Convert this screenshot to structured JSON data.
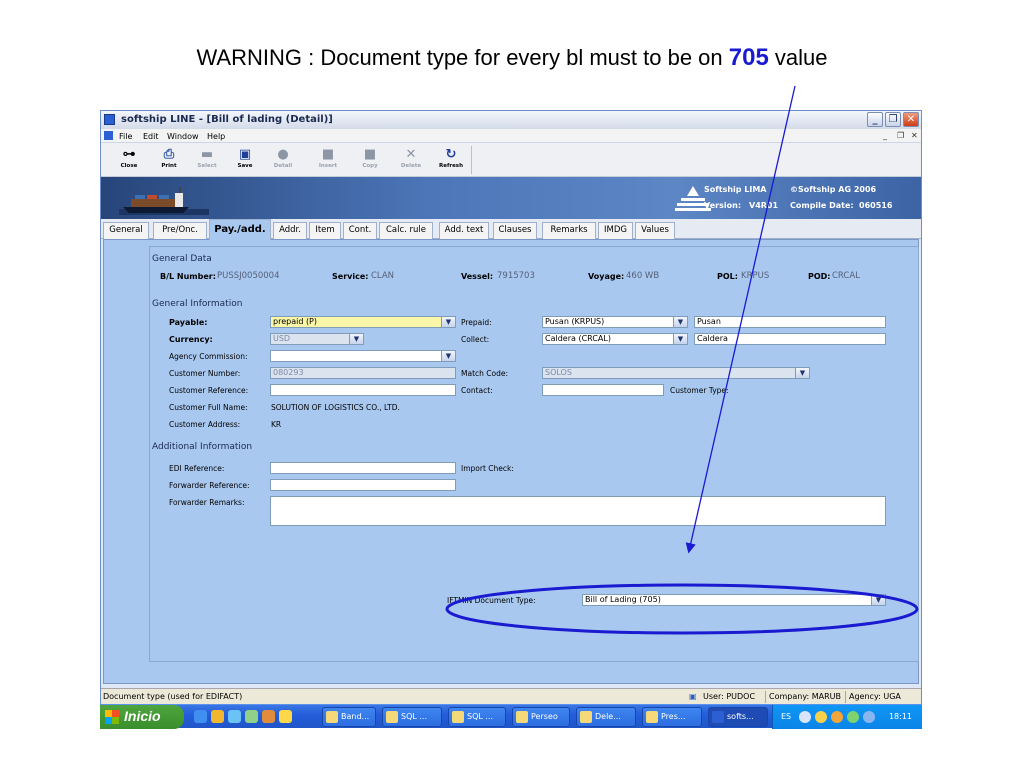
{
  "slide": {
    "warning_prefix": "WARNING : Document type for every bl must to be on ",
    "warning_highlight": "705",
    "warning_suffix": " value"
  },
  "window": {
    "title": "softship LINE - [Bill of lading (Detail)]",
    "controls": {
      "minimize": "_",
      "restore": "❐",
      "close": "✕"
    }
  },
  "menu": {
    "items": [
      "File",
      "Edit",
      "Window",
      "Help"
    ],
    "mdi_controls": [
      "_",
      "❐",
      "✕"
    ]
  },
  "toolbar": {
    "buttons": [
      {
        "label": "Close",
        "icon": "key-icon",
        "glyph": "⊶",
        "enabled": true
      },
      {
        "label": "Print",
        "icon": "print-icon",
        "glyph": "⎙",
        "enabled": true
      },
      {
        "label": "Select",
        "icon": "select-icon",
        "glyph": "▬",
        "enabled": false
      },
      {
        "label": "Save",
        "icon": "save-icon",
        "glyph": "▣",
        "enabled": true
      },
      {
        "label": "Detail",
        "icon": "detail-icon",
        "glyph": "●",
        "enabled": false
      },
      {
        "label": "Insert",
        "icon": "insert-icon",
        "glyph": "■",
        "enabled": false
      },
      {
        "label": "Copy",
        "icon": "copy-icon",
        "glyph": "■",
        "enabled": false
      },
      {
        "label": "Delete",
        "icon": "delete-icon",
        "glyph": "✕",
        "enabled": false
      },
      {
        "label": "Refresh",
        "icon": "refresh-icon",
        "glyph": "↻",
        "enabled": true
      }
    ]
  },
  "banner": {
    "company": "Softship LIMA",
    "copyright": "©Softship AG 2006",
    "version_label": "Version:",
    "version_value": "V4R01",
    "compile_label": "Compile Date:",
    "compile_value": "060516"
  },
  "tabs": [
    "General",
    "Pre/Onc.",
    "Pay./add.",
    "Addr.",
    "Item",
    "Cont.",
    "Calc. rule",
    "Add. text",
    "Clauses",
    "Remarks",
    "IMDG",
    "Values"
  ],
  "active_tab": "Pay./add.",
  "general_data": {
    "heading": "General Data",
    "bl_number_label": "B/L Number:",
    "bl_number": "PUSSJ0050004",
    "service_label": "Service:",
    "service": "CLAN",
    "vessel_label": "Vessel:",
    "vessel": "7915703",
    "voyage_label": "Voyage:",
    "voyage": "460 WB",
    "pol_label": "POL:",
    "pol": "KRPUS",
    "pod_label": "POD:",
    "pod": "CRCAL"
  },
  "general_info": {
    "heading": "General Information",
    "payable_label": "Payable:",
    "payable": "prepaid     (P)",
    "currency_label": "Currency:",
    "currency": "USD",
    "agency_commission_label": "Agency Commission:",
    "agency_commission": "",
    "customer_number_label": "Customer Number:",
    "customer_number": "080293",
    "customer_reference_label": "Customer Reference:",
    "customer_reference": "",
    "customer_full_name_label": "Customer Full Name:",
    "customer_full_name": "SOLUTION OF LOGISTICS CO., LTD.",
    "customer_address_label": "Customer Address:",
    "customer_address": "KR",
    "prepaid_label": "Prepaid:",
    "prepaid_select": "Pusan       (KRPUS)",
    "prepaid_text": "Pusan",
    "collect_label": "Collect:",
    "collect_select": "Caldera      (CRCAL)",
    "collect_text": "Caldera",
    "match_code_label": "Match Code:",
    "match_code": "SOLOS",
    "contact_label": "Contact:",
    "contact": "",
    "customer_type_label": "Customer Type:"
  },
  "additional_info": {
    "heading": "Additional Information",
    "edi_reference_label": "EDI Reference:",
    "edi_reference": "",
    "forwarder_reference_label": "Forwarder Reference:",
    "forwarder_reference": "",
    "forwarder_remarks_label": "Forwarder Remarks:",
    "forwarder_remarks": "",
    "import_check_label": "Import Check:",
    "iftmin_label": "IFTMIN Document Type:",
    "iftmin_value": "Bill of Lading     (705)"
  },
  "statusbar": {
    "hint": "Document type (used for EDIFACT)",
    "user": "User: PUDOC",
    "company": "Company: MARUB",
    "agency": "Agency: UGA"
  },
  "taskbar": {
    "start_label": "Inicio",
    "tasks": [
      "Band...",
      "SQL ...",
      "SQL ...",
      "Perseo",
      "Dele...",
      "Pres...",
      "softs..."
    ],
    "language": "ES",
    "clock": "18:11"
  },
  "colors": {
    "annotation": "#1a1ad0",
    "panel": "#a9c8f0",
    "highlight_field": "#fbf7a8"
  }
}
